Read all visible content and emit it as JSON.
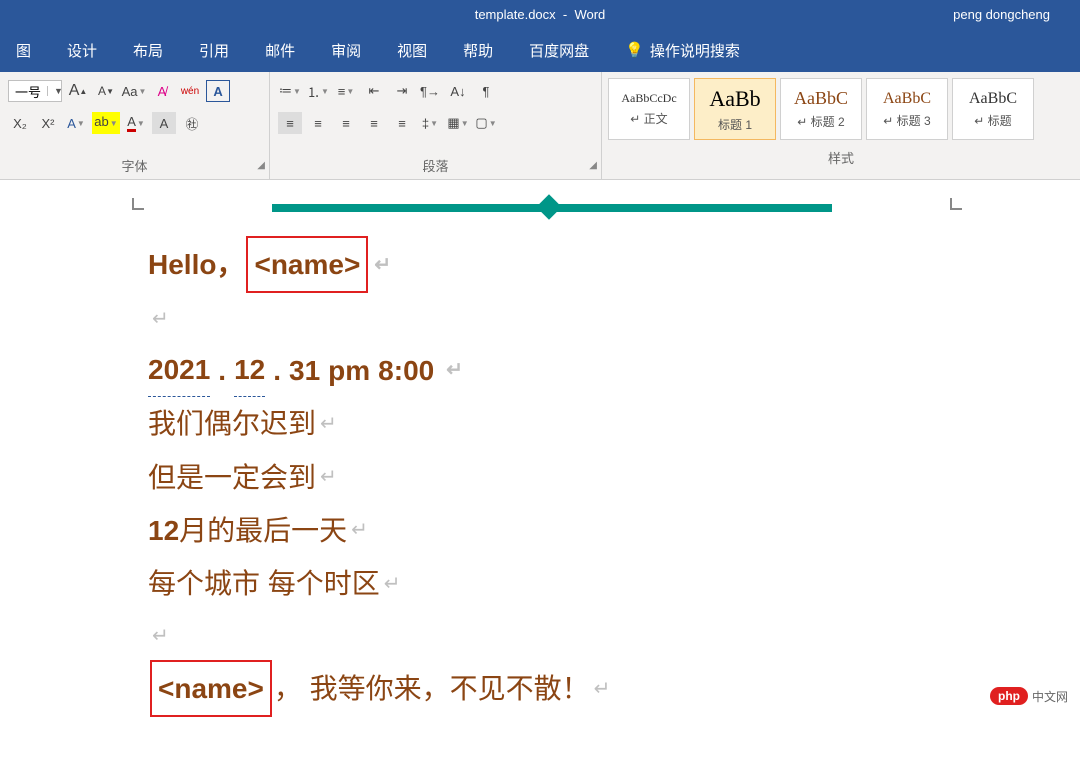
{
  "titlebar": {
    "filename": "template.docx",
    "app": "Word",
    "user": "peng dongcheng"
  },
  "menubar": {
    "items": [
      "图",
      "设计",
      "布局",
      "引用",
      "邮件",
      "审阅",
      "视图",
      "帮助",
      "百度网盘"
    ],
    "tell_me": "操作说明搜索"
  },
  "ribbon": {
    "font": {
      "label": "字体",
      "size_display": "一号",
      "grow": "A",
      "shrink": "A",
      "case": "Aa",
      "clear": "⌫",
      "phonetic": "wén",
      "charborder": "A",
      "sub": "X₂",
      "sup": "X²",
      "effects": "A",
      "highlight": "ab",
      "color": "A",
      "charshade": "A",
      "circled": "㊓"
    },
    "paragraph": {
      "label": "段落",
      "bullets": "•",
      "numbers": "1",
      "multilevel": "≡",
      "dec": "≡",
      "inc": "≡",
      "sort": "A↓",
      "show": "¶",
      "alignL": "≡",
      "alignC": "≡",
      "alignR": "≡",
      "alignJ": "≡",
      "alignD": "≡",
      "spacing": "‡",
      "shading": "▦",
      "borders": "▢"
    },
    "styles": {
      "label": "样式",
      "items": [
        {
          "preview": "AaBbCcDc",
          "name": "正文",
          "size": "12px"
        },
        {
          "preview": "AaBb",
          "name": "标题 1",
          "size": "22px",
          "selected": true,
          "color": "#000"
        },
        {
          "preview": "AaBbC",
          "name": "标题 2",
          "size": "18px",
          "color": "#8B4513"
        },
        {
          "preview": "AaBbC",
          "name": "标题 3",
          "size": "16px",
          "color": "#8B4513"
        },
        {
          "preview": "AaBbC",
          "name": "标题",
          "size": "16px"
        }
      ]
    }
  },
  "document": {
    "greeting_prefix": "Hello，",
    "placeholder": "<name>",
    "date_parts": {
      "y": "2021",
      "d1": ".",
      "m": "12",
      "d2": ".",
      "d": "31",
      "ampm": "pm",
      "t": "8:00"
    },
    "line3": "我们偶尔迟到",
    "line4": "但是一定会到",
    "line5_bold": "12",
    "line5_rest": " 月的最后一天",
    "line6": "每个城市 每个时区",
    "line8_rest": "， 我等你来，不见不散！"
  },
  "watermark": {
    "pill": "php",
    "text": "中文网"
  }
}
